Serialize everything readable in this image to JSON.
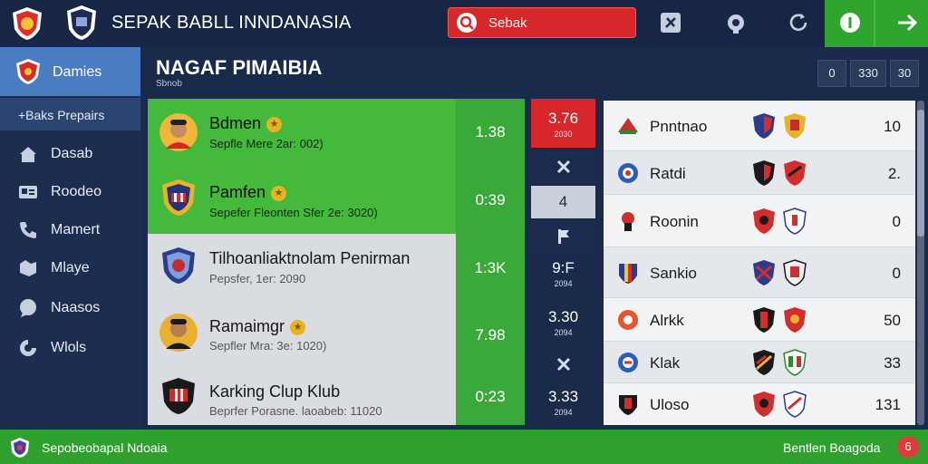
{
  "header": {
    "title": "SEPAK BABLL INNDANASIA",
    "search_label": "Sebak",
    "icons": [
      "club-logo",
      "shield-logo",
      "search-icon",
      "tools-icon",
      "camera-icon",
      "refresh-icon",
      "info-icon",
      "arrow-right-icon"
    ]
  },
  "sidebar": {
    "active": "Damies",
    "sub": "+Baks Prepairs",
    "items": [
      {
        "label": "Dasab",
        "icon": "home-icon"
      },
      {
        "label": "Roodeo",
        "icon": "id-card-icon"
      },
      {
        "label": "Mamert",
        "icon": "phone-icon"
      },
      {
        "label": "Mlaye",
        "icon": "tag-icon"
      },
      {
        "label": "Naasos",
        "icon": "chat-icon"
      },
      {
        "label": "Wlols",
        "icon": "settings-icon"
      }
    ]
  },
  "section": {
    "title": "NAGAF PIMAIBIA",
    "subtitle": "Sbnob",
    "pager": [
      "0",
      "330",
      "30"
    ]
  },
  "matches": [
    {
      "name": "Bdmen",
      "meta": "Sepfle Mere 2ar: 002)",
      "odds": "1.38",
      "style": "green",
      "star": true
    },
    {
      "name": "Pamfen",
      "meta": "Sepefer Fleonten Sfer 2e: 3020)",
      "odds": "0:39",
      "style": "green",
      "star": true
    },
    {
      "name": "Tilhoanliaktnolam Penirman",
      "meta": "Pepsfer, 1er: 2090",
      "odds": "1:3K",
      "style": "grey",
      "star": false
    },
    {
      "name": "Ramaimgr",
      "meta": "Sepfler Mra: 3e: 1020)",
      "odds": "7.98",
      "style": "grey",
      "star": true
    },
    {
      "name": "Karking Clup Klub",
      "meta": "Beprfer Porasne. laoabeb: 11020",
      "odds": "0:23",
      "style": "grey",
      "star": false
    }
  ],
  "center": [
    {
      "big": "3.76",
      "small": "2030",
      "style": "red"
    },
    {
      "icon": "close-icon"
    },
    {
      "big": "4",
      "style": "light"
    },
    {
      "icon": "flag-icon"
    },
    {
      "big": "9:F",
      "small": "2094"
    },
    {
      "big": "3.30",
      "small": "2094"
    },
    {
      "icon": "close-icon"
    },
    {
      "big": "3.33",
      "small": "2094"
    }
  ],
  "standings": [
    {
      "name": "Pnntnao",
      "value": "10"
    },
    {
      "name": "Ratdi",
      "value": "2."
    },
    {
      "name": "Roonin",
      "value": "0"
    },
    {
      "name": "Sankio",
      "value": "0"
    },
    {
      "name": "Alrkk",
      "value": "50"
    },
    {
      "name": "Klak",
      "value": "33"
    },
    {
      "name": "Uloso",
      "value": "131"
    }
  ],
  "footer": {
    "left": "Sepobeobapal Ndoaia",
    "right": "Bentlen Boagoda",
    "badge": "6"
  },
  "colors": {
    "navy": "#182646",
    "green": "#2fa02d",
    "red": "#d6272a",
    "sidebar_active": "#4a7cc1"
  }
}
